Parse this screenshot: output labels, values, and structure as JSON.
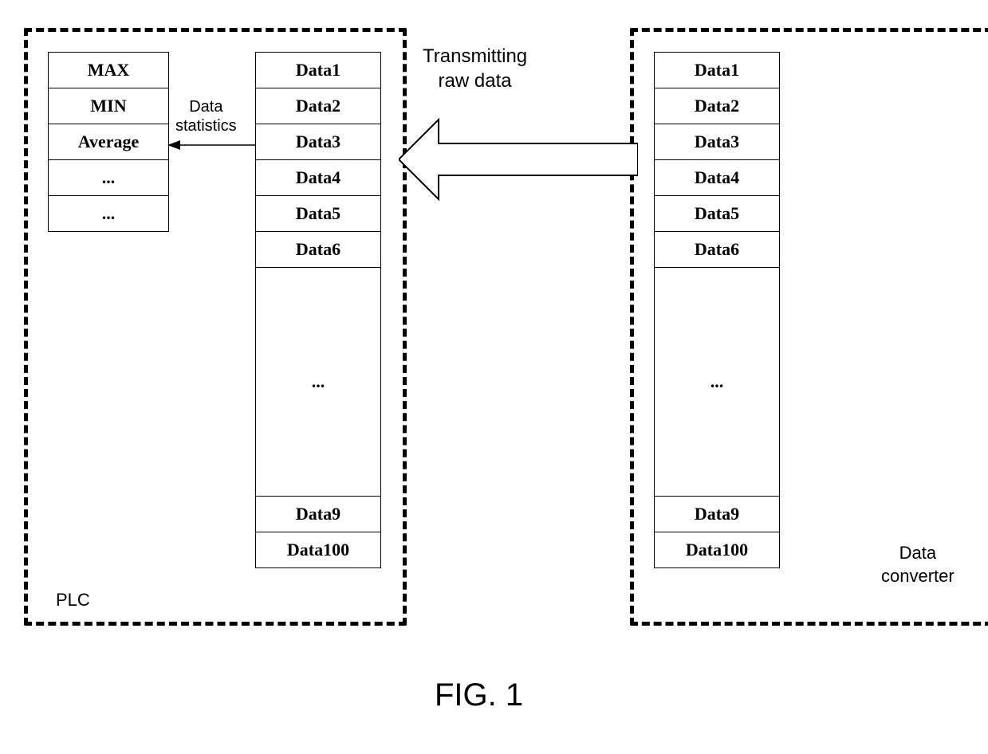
{
  "stats": {
    "rows": [
      "MAX",
      "MIN",
      "Average",
      "...",
      "..."
    ]
  },
  "data_items": [
    "Data1",
    "Data2",
    "Data3",
    "Data4",
    "Data5",
    "Data6",
    "...",
    "Data9",
    "Data100"
  ],
  "labels": {
    "plc": "PLC",
    "converter_line1": "Data",
    "converter_line2": "converter",
    "stats_line1": "Data",
    "stats_line2": "statistics",
    "transmit_line1": "Transmitting",
    "transmit_line2": "raw data",
    "figure": "FIG. 1"
  }
}
